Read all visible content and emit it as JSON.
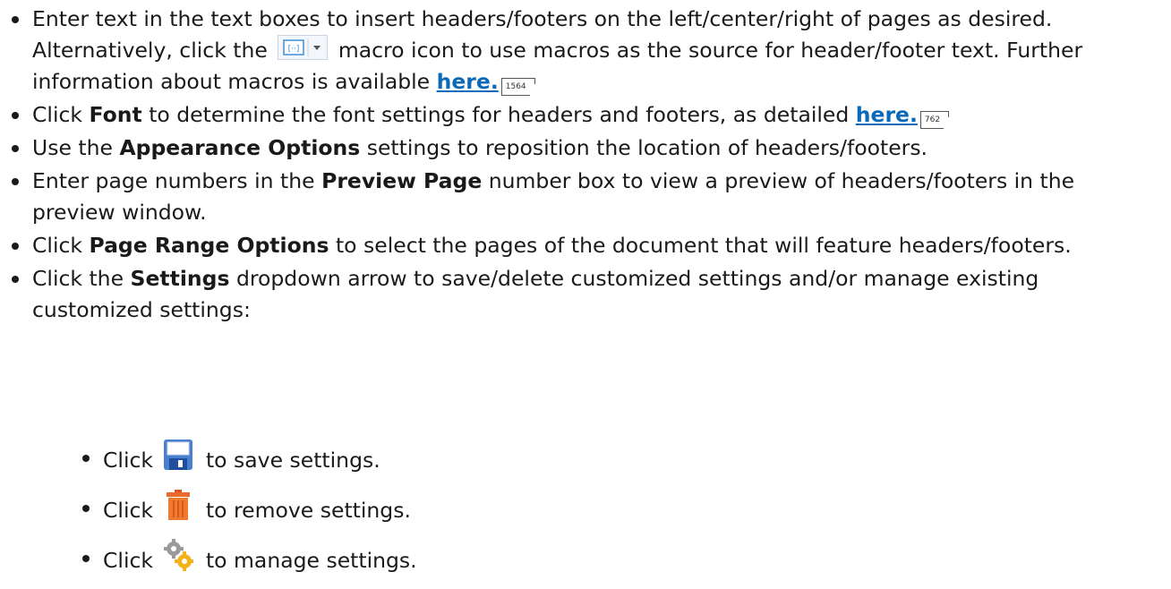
{
  "bullets": {
    "b1": {
      "text_1": "Enter text in the text boxes to insert headers/footers on the left/center/right of pages as desired. Alternatively, click the",
      "text_2": "macro icon to use macros as the source for header/footer text. Further information about macros is available",
      "link": "here.",
      "ref": "1564"
    },
    "b2": {
      "text_1": "Click",
      "bold": "Font",
      "text_2": "to determine the font settings for headers and footers, as detailed",
      "link": "here.",
      "ref": "762"
    },
    "b3": {
      "text_1": "Use the",
      "bold": "Appearance Options",
      "text_2": "settings to reposition the location of headers/footers."
    },
    "b4": {
      "text_1": "Enter page numbers in the",
      "bold": "Preview Page",
      "text_2": "number box to view a preview of headers/footers in the preview window."
    },
    "b5": {
      "text_1": "Click",
      "bold": "Page Range Options",
      "text_2": "to select the pages of the document that will feature headers/footers."
    },
    "b6": {
      "text_1": "Click the",
      "bold": "Settings",
      "text_2": "dropdown arrow to save/delete customized settings and/or manage existing customized settings:"
    }
  },
  "sub_bullets": {
    "s1": {
      "text_1": "Click",
      "text_2": "to save settings."
    },
    "s2": {
      "text_1": "Click",
      "text_2": "to remove settings."
    },
    "s3": {
      "text_1": "Click",
      "text_2": "to manage settings."
    }
  },
  "icons": {
    "macro": "macro-icon",
    "save": "save-icon",
    "delete": "trash-icon",
    "manage": "gears-icon"
  },
  "colors": {
    "link": "#0a6ab8",
    "text": "#1a1a1a"
  }
}
